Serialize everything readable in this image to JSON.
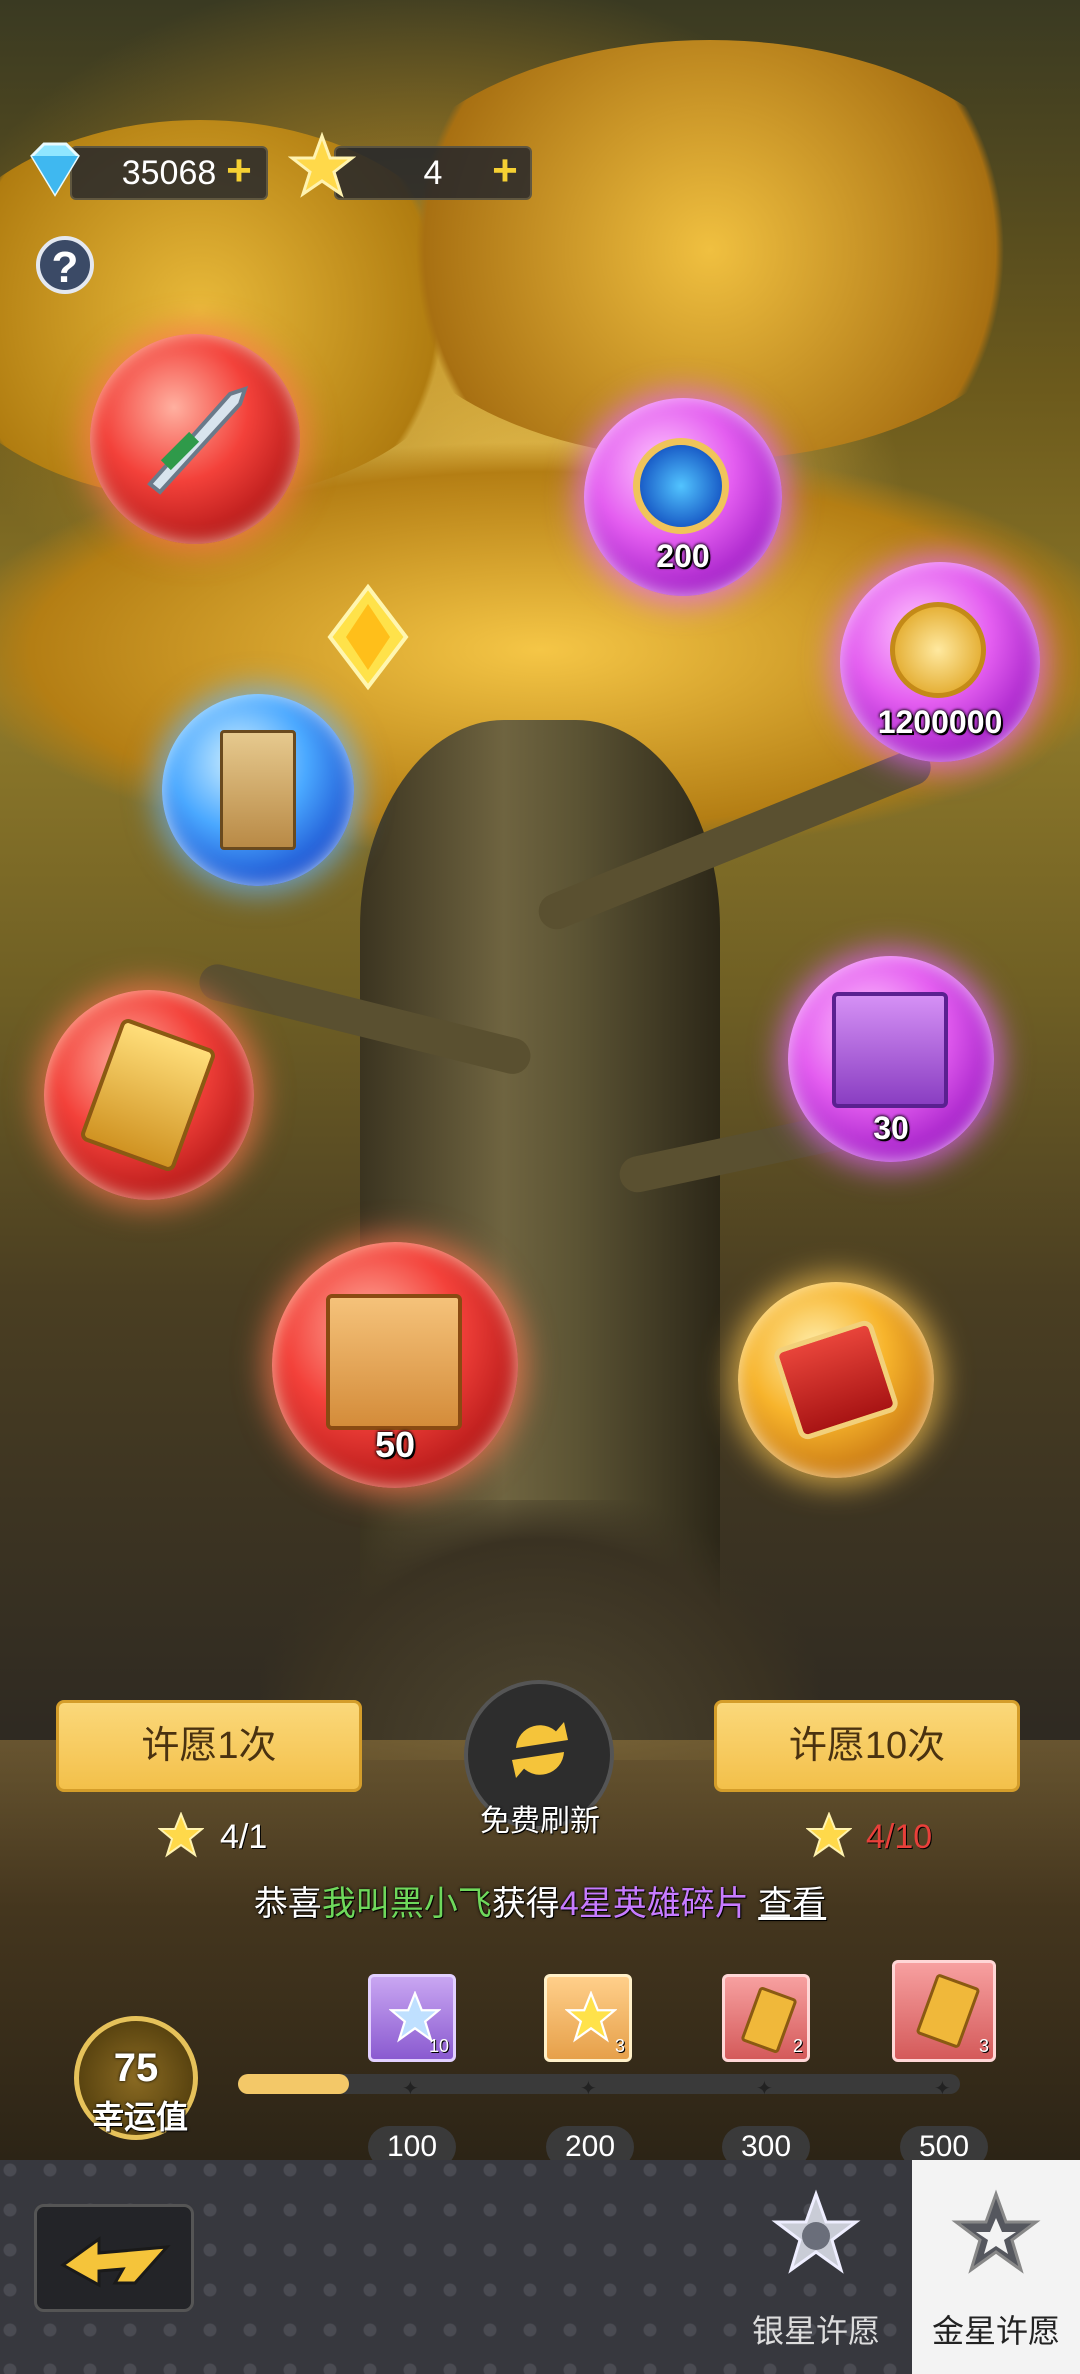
{
  "currency": {
    "diamond": "35068",
    "star": "4"
  },
  "bubbles": {
    "orb_blue": "200",
    "gold_coin": "1200000",
    "hero_purple": "30",
    "hero_red": "50"
  },
  "buttons": {
    "wish_once": "许愿1次",
    "wish_ten": "许愿10次",
    "free_refresh": "免费刷新"
  },
  "costs": {
    "once": "4/1",
    "ten": "4/10"
  },
  "notice": {
    "prefix": "恭喜",
    "player": "我叫黑小飞",
    "middle": "获得",
    "item": "4星英雄碎片",
    "link": "查看"
  },
  "lucky": {
    "value": "75",
    "label": "幸运值"
  },
  "progress": {
    "current": 75,
    "max": 500,
    "milestones": [
      "100",
      "200",
      "300",
      "500"
    ],
    "reward_counts": [
      "10",
      "3",
      "2",
      "3"
    ]
  },
  "tabs": {
    "silver": "银星许愿",
    "gold": "金星许愿"
  },
  "colors": {
    "accent": "#f3c04a",
    "warning": "#e8403a",
    "green": "#6fd85b",
    "purple": "#c77bff"
  }
}
